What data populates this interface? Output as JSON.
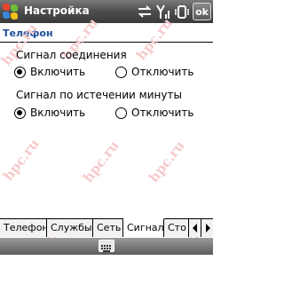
{
  "titlebar": {
    "title": "Настройка",
    "ok_label": "ok",
    "icons": [
      "start-menu-icon",
      "connectivity-icon",
      "signal-strength-icon",
      "volume-icon"
    ]
  },
  "page": {
    "header": "Телефон"
  },
  "groups": [
    {
      "label": "Сигнал соединения",
      "options": [
        "Включить",
        "Отключить"
      ],
      "selected": "Включить"
    },
    {
      "label": "Сигнал по истечении минуты",
      "options": [
        "Включить",
        "Отключить"
      ],
      "selected": "Включить"
    }
  ],
  "tabs": [
    {
      "label": "Телефон",
      "active": false
    },
    {
      "label": "Службы",
      "active": false
    },
    {
      "label": "Сеть",
      "active": false
    },
    {
      "label": "Сигнал",
      "active": true
    },
    {
      "label": "Сто",
      "active": false
    }
  ],
  "watermark": "hpc.ru",
  "colors": {
    "title_bar": "#4d4d4d",
    "header_text": "#1e4f9c",
    "watermark": "#f6caca"
  }
}
